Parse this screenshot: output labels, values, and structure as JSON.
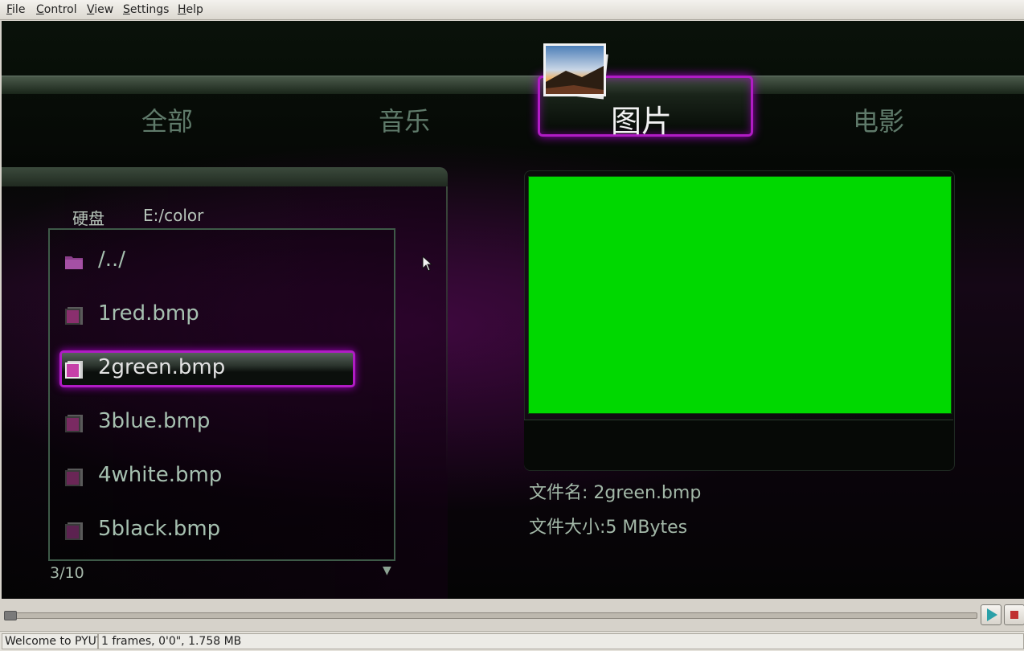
{
  "menubar": {
    "items": [
      {
        "label": "File",
        "mnemonic": "F",
        "rest": "ile"
      },
      {
        "label": "Control",
        "mnemonic": "C",
        "rest": "ontrol"
      },
      {
        "label": "View",
        "mnemonic": "V",
        "rest": "iew"
      },
      {
        "label": "Settings",
        "mnemonic": "S",
        "rest": "ettings"
      },
      {
        "label": "Help",
        "mnemonic": "H",
        "rest": "elp"
      }
    ]
  },
  "tabs": [
    {
      "label": "全部"
    },
    {
      "label": "音乐"
    },
    {
      "label": "图片",
      "active": true
    },
    {
      "label": "电影"
    }
  ],
  "browser": {
    "device": "硬盘",
    "path": "E:/color",
    "items": [
      {
        "name": "/../",
        "icon": "folder-icon"
      },
      {
        "name": "1red.bmp",
        "icon": "file-icon"
      },
      {
        "name": "2green.bmp",
        "icon": "file-icon",
        "selected": true
      },
      {
        "name": "3blue.bmp",
        "icon": "file-icon"
      },
      {
        "name": "4white.bmp",
        "icon": "file-icon"
      },
      {
        "name": "5black.bmp",
        "icon": "file-icon"
      }
    ],
    "pager": "3/10",
    "scroll_icon": "down-triangle-icon"
  },
  "preview": {
    "color": "#00d800",
    "filename_line": "文件名: 2green.bmp",
    "filesize_line": "文件大小:5 MBytes"
  },
  "colors": {
    "accent": "#b01cc4",
    "tab_inactive": "#5f7a6a",
    "text_list": "#a6c0b0"
  },
  "playback": {
    "position": 0.0,
    "play_icon": "play-icon",
    "stop_icon": "stop-icon"
  },
  "status": {
    "message": "Welcome to PYUV",
    "frame_info": "1 frames, 0'0\", 1.758 MB"
  }
}
